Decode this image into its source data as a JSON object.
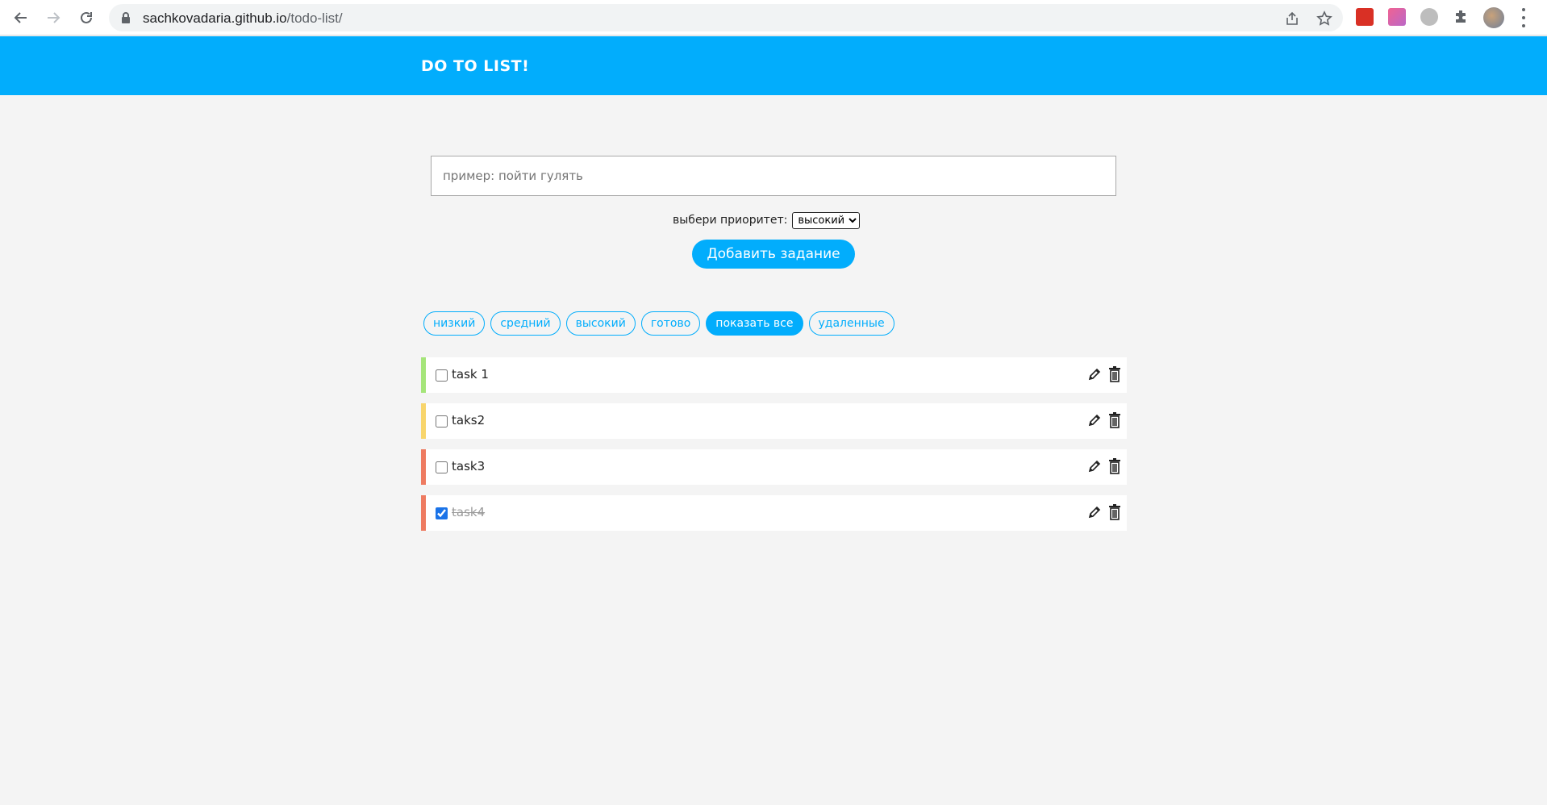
{
  "browser": {
    "url_domain": "sachkovadaria.github.io",
    "url_path": "/todo-list/"
  },
  "app": {
    "title": "DO TO LIST!"
  },
  "form": {
    "input_placeholder": "пример: пойти гулять",
    "input_value": "",
    "priority_label": "выбери приоритет:",
    "priority_selected": "высокий",
    "add_button_label": "Добавить задание"
  },
  "filters": [
    {
      "label": "низкий",
      "active": false
    },
    {
      "label": "средний",
      "active": false
    },
    {
      "label": "высокий",
      "active": false
    },
    {
      "label": "готово",
      "active": false
    },
    {
      "label": "показать все",
      "active": true
    },
    {
      "label": "удаленные",
      "active": false
    }
  ],
  "tasks": [
    {
      "text": "task 1",
      "done": false,
      "priority_color": "#a5e57a"
    },
    {
      "text": "taks2",
      "done": false,
      "priority_color": "#f8d56c"
    },
    {
      "text": "task3",
      "done": false,
      "priority_color": "#ee7b61"
    },
    {
      "text": "task4",
      "done": true,
      "priority_color": "#ee7b61"
    }
  ],
  "colors": {
    "accent": "#02adfc",
    "background": "#f4f4f4"
  }
}
